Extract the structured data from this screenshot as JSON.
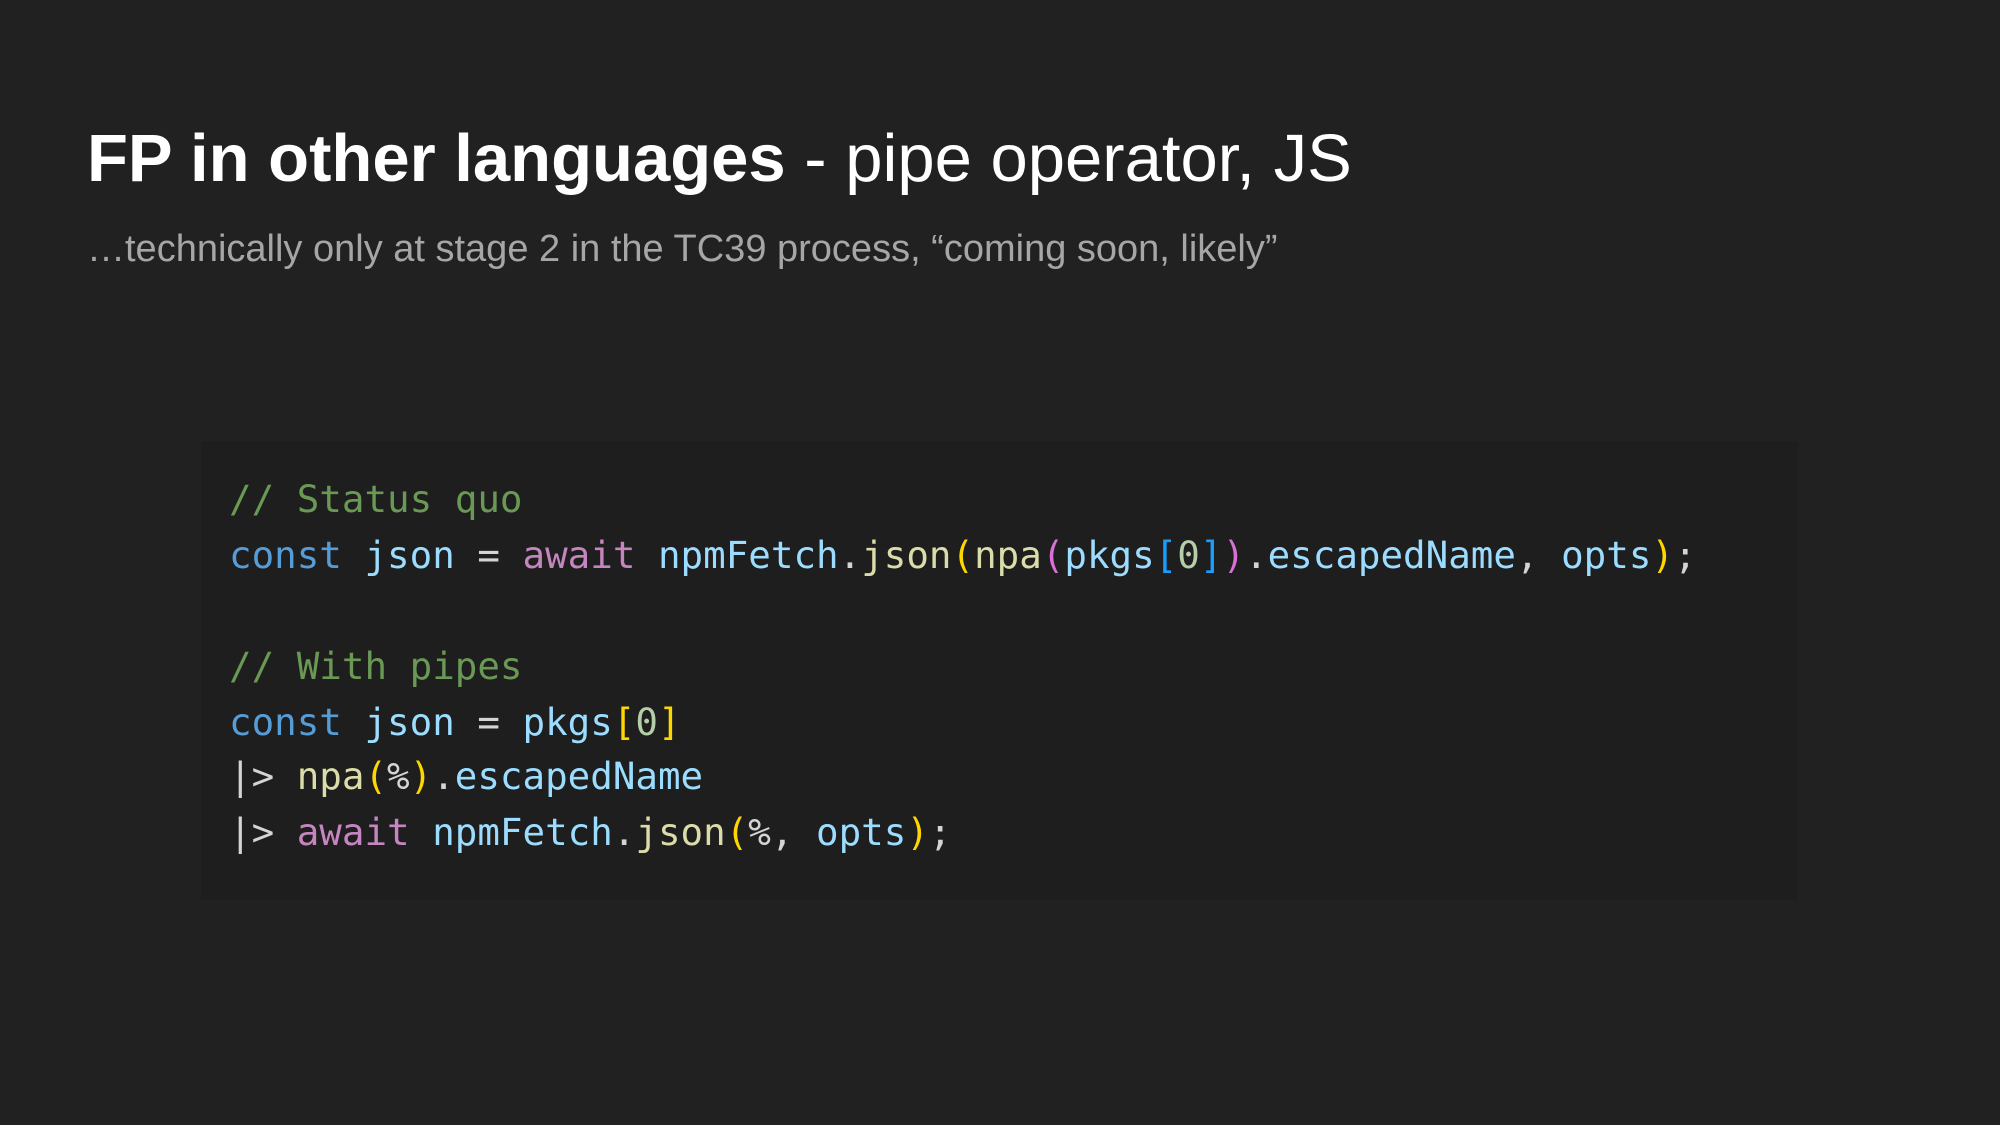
{
  "slide": {
    "title_bold": "FP in other languages",
    "title_rest": " - pipe operator, JS",
    "subtitle": "…technically only at stage 2 in the TC39 process, “coming soon, likely”"
  },
  "code": {
    "lines": [
      [
        {
          "text": "// Status quo",
          "kind": "comment"
        }
      ],
      [
        {
          "text": "const",
          "kind": "keyword"
        },
        {
          "text": " ",
          "kind": "op"
        },
        {
          "text": "json",
          "kind": "var"
        },
        {
          "text": " = ",
          "kind": "op"
        },
        {
          "text": "await",
          "kind": "control"
        },
        {
          "text": " ",
          "kind": "op"
        },
        {
          "text": "npmFetch",
          "kind": "var"
        },
        {
          "text": ".",
          "kind": "op"
        },
        {
          "text": "json",
          "kind": "func"
        },
        {
          "text": "(",
          "kind": "br1"
        },
        {
          "text": "npa",
          "kind": "func"
        },
        {
          "text": "(",
          "kind": "br2"
        },
        {
          "text": "pkgs",
          "kind": "var"
        },
        {
          "text": "[",
          "kind": "br3"
        },
        {
          "text": "0",
          "kind": "num"
        },
        {
          "text": "]",
          "kind": "br3"
        },
        {
          "text": ")",
          "kind": "br2"
        },
        {
          "text": ".",
          "kind": "op"
        },
        {
          "text": "escapedName",
          "kind": "var"
        },
        {
          "text": ", ",
          "kind": "op"
        },
        {
          "text": "opts",
          "kind": "var"
        },
        {
          "text": ")",
          "kind": "br1"
        },
        {
          "text": ";",
          "kind": "op"
        }
      ],
      [
        {
          "text": "// With pipes",
          "kind": "comment"
        }
      ],
      [
        {
          "text": "const",
          "kind": "keyword"
        },
        {
          "text": " ",
          "kind": "op"
        },
        {
          "text": "json",
          "kind": "var"
        },
        {
          "text": " = ",
          "kind": "op"
        },
        {
          "text": "pkgs",
          "kind": "var"
        },
        {
          "text": "[",
          "kind": "br1"
        },
        {
          "text": "0",
          "kind": "num"
        },
        {
          "text": "]",
          "kind": "br1"
        }
      ],
      [
        {
          "text": "|> ",
          "kind": "op"
        },
        {
          "text": "npa",
          "kind": "func"
        },
        {
          "text": "(",
          "kind": "br1"
        },
        {
          "text": "%",
          "kind": "op"
        },
        {
          "text": ")",
          "kind": "br1"
        },
        {
          "text": ".",
          "kind": "op"
        },
        {
          "text": "escapedName",
          "kind": "var"
        }
      ],
      [
        {
          "text": "|> ",
          "kind": "op"
        },
        {
          "text": "await",
          "kind": "control"
        },
        {
          "text": " ",
          "kind": "op"
        },
        {
          "text": "npmFetch",
          "kind": "var"
        },
        {
          "text": ".",
          "kind": "op"
        },
        {
          "text": "json",
          "kind": "func"
        },
        {
          "text": "(",
          "kind": "br1"
        },
        {
          "text": "%, ",
          "kind": "op"
        },
        {
          "text": "opts",
          "kind": "var"
        },
        {
          "text": ")",
          "kind": "br1"
        },
        {
          "text": ";",
          "kind": "op"
        }
      ]
    ]
  },
  "colors": {
    "background": "#212121",
    "code_background": "#1e1e1e",
    "title": "#ffffff",
    "subtitle": "#a6a6a6",
    "comment": "#6a9955",
    "keyword": "#569cd6",
    "control": "#c586c0",
    "variable": "#9cdcfe",
    "function": "#dcdcaa",
    "bracket_1": "#ffd700",
    "bracket_2": "#da70d6",
    "bracket_3": "#179fff"
  }
}
